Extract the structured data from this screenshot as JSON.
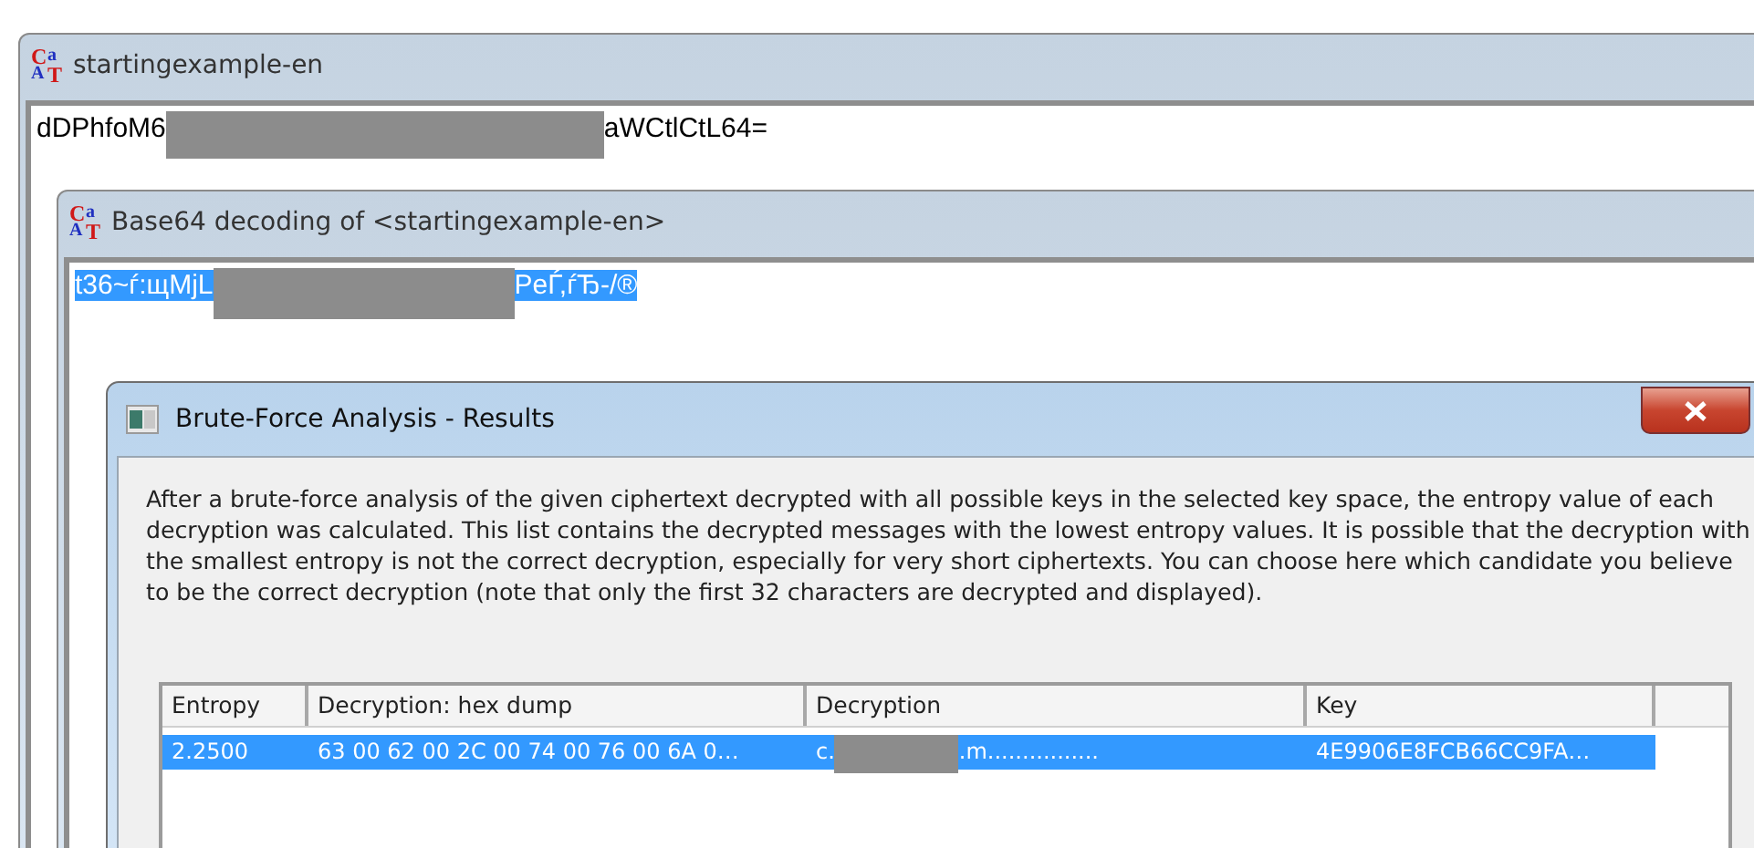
{
  "main_window": {
    "logo_letters": [
      "C",
      "a",
      "A",
      "T"
    ],
    "title": "startingexample-en",
    "text_start": "dDPhfoM6",
    "text_end": "aWCtlCtL64=",
    "text_selected": false
  },
  "decode_window": {
    "logo_letters": [
      "C",
      "a",
      "A",
      "T"
    ],
    "title": "Base64 decoding of <startingexample-en>",
    "text_start": "t36~ѓ:щMjL",
    "text_end": "PeЃ,ѓЂ-/®",
    "text_selected": true
  },
  "results_dialog": {
    "title": "Brute-Force Analysis - Results",
    "description": "After a brute-force analysis of the given ciphertext decrypted with all possible keys in the selected key space, the entropy value of each decryption was calculated. This list contains the decrypted messages with the lowest entropy values. It is possible that the decryption with the smallest entropy is not the correct decryption, especially for very short ciphertexts. You can choose here which candidate you believe to be the correct decryption (note that only the first 32 characters are decrypted and displayed).",
    "table": {
      "columns": [
        "Entropy",
        "Decryption: hex dump",
        "Decryption",
        "Key"
      ],
      "rows": [
        {
          "selected": true,
          "entropy": "2.2500",
          "hex_dump": "63 00 62 00 2C 00 74 00 76 00 6A 0…",
          "decryption_start": "c.",
          "decryption_end": ".m................",
          "key": "4E9906E8FCB66CC9FA…"
        }
      ]
    }
  }
}
